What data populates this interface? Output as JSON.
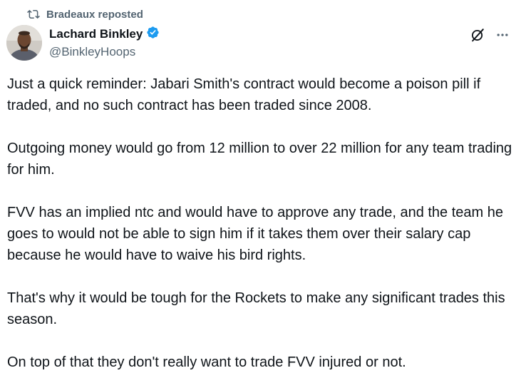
{
  "repost": {
    "icon": "repost-icon",
    "text": "Bradeaux reposted"
  },
  "author": {
    "avatar": "avatar",
    "name": "Lachard Binkley",
    "verified_icon": "verified-badge-icon",
    "verified_color": "#1d9bf0",
    "handle": "@BinkleyHoops"
  },
  "actions": {
    "grok_icon": "grok-icon",
    "more_icon": "more-options-icon"
  },
  "post": {
    "paragraphs": [
      "Just a quick reminder: Jabari Smith's contract would become a poison pill if traded, and no such contract has been traded since 2008.",
      "Outgoing money would go from 12 million to over 22 million for any team trading for him.",
      "FVV has an implied ntc and would have to approve any trade, and the team he goes to would not be able to sign him if it takes them over their salary cap because he would have to waive his bird rights.",
      "That's why it would be tough for the Rockets to make any significant trades this season.",
      "On top of that they don't really want to trade FVV injured or not."
    ]
  },
  "colors": {
    "text_primary": "#0f1419",
    "text_secondary": "#536471",
    "background": "#ffffff"
  }
}
